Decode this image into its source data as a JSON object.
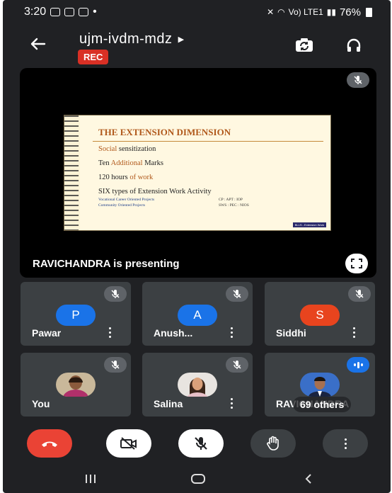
{
  "status_bar": {
    "time": "3:20",
    "network": "Vo) LTE1",
    "battery": "76%"
  },
  "header": {
    "meeting_code": "ujm-ivdm-mdz",
    "rec_label": "REC",
    "icons": [
      "back-arrow-icon",
      "switch-camera-icon",
      "audio-output-icon"
    ]
  },
  "presentation": {
    "presenter_text": "RAVICHANDRA is presenting",
    "slide": {
      "title": "THE EXTENSION DIMENSION",
      "line1_accent": "Social",
      "line1_rest": "sensitization",
      "line2_a": "Ten",
      "line2_accent": "Additional",
      "line2_b": "Marks",
      "line3_a": "120 hours",
      "line3_accent": "of work",
      "line4": "SIX types of Extension Work Activity",
      "sub1_left": "Vocational Career Oriented Projects",
      "sub1_right": "CP : APT : IOP",
      "sub2_left": "Community Oriented Projects",
      "sub2_right": "SWS : PEC : NIOS",
      "footer": "BLLS - Extension Work"
    }
  },
  "participants": [
    {
      "name": "Pawar",
      "initial": "P",
      "color": "#1a73e8",
      "muted": true
    },
    {
      "name": "Anush...",
      "initial": "A",
      "color": "#1a73e8",
      "muted": true
    },
    {
      "name": "Siddhi",
      "initial": "S",
      "color": "#e8441e",
      "muted": true
    },
    {
      "name": "You",
      "muted": true
    },
    {
      "name": "Salina",
      "muted": true
    },
    {
      "name": "RAVICHANDRA",
      "others_label": "69 others",
      "speaking": true
    }
  ],
  "controls": [
    "end-call",
    "camera-off",
    "mic-off",
    "raise-hand",
    "more-options"
  ],
  "colors": {
    "background": "#202124",
    "tile": "#3c4043",
    "end_call": "#ea4335",
    "rec": "#d93025",
    "accent": "#1a73e8"
  }
}
